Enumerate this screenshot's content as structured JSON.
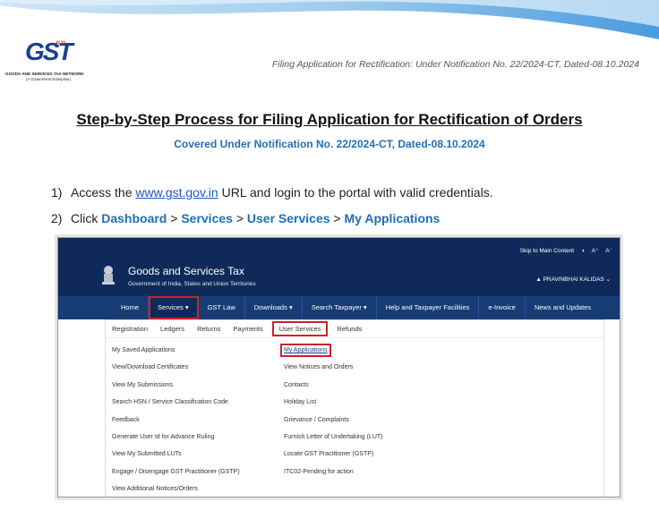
{
  "logo": {
    "text": "GST",
    "arrows": "«»",
    "line1": "GOODS AND SERVICES TAX NETWORK",
    "line2": "(A Government Enterprise)"
  },
  "header_note": "Filing Application for Rectification: Under Notification No. 22/2024-CT, Dated-08.10.2024",
  "title": "Step-by-Step Process for Filing Application for Rectification of Orders",
  "subtitle": "Covered Under Notification No. 22/2024-CT, Dated-08.10.2024",
  "steps": [
    {
      "num": "1)",
      "pre": "Access the ",
      "link": "www.gst.gov.in",
      "post": " URL and login to the portal with valid credentials."
    },
    {
      "num": "2)",
      "pre": "Click ",
      "path": [
        "Dashboard",
        "Services",
        "User Services",
        "My Applications"
      ],
      "sep": " > "
    }
  ],
  "portal": {
    "topbar": [
      "Skip to Main Content",
      "◑",
      "A⁺",
      "A⁻"
    ],
    "site_title": "Goods and Services Tax",
    "site_sub": "Government of India, States and Union Territories",
    "user": "▲ PRAVINBHAI KALIDAS ⌄",
    "nav": [
      "Home",
      "Services ▾",
      "GST Law",
      "Downloads ▾",
      "Search Taxpayer ▾",
      "Help and Taxpayer Facilities",
      "e-Invoice",
      "News and Updates"
    ],
    "sub_tabs": [
      "Registration",
      "Ledgers",
      "Returns",
      "Payments",
      "User Services",
      "Refunds"
    ],
    "left_links": [
      "My Saved Applications",
      "View/Download Certificates",
      "View My Submissions",
      "Search HSN / Service Classification Code",
      "Feedback",
      "Generate User Id for Advance Ruling",
      "View My Submitted LUTs",
      "Engage / Disengage GST Practitioner (GSTP)",
      "View Additional Notices/Orders"
    ],
    "right_links": [
      "My Applications",
      "View Notices and Orders",
      "Contacts",
      "Holiday List",
      "Grievance / Complaints",
      "Furnish Letter of Undertaking (LUT)",
      "Locate GST Practitioner (GSTP)",
      "ITC02-Pending for action"
    ]
  },
  "colors": {
    "accent": "#1f6fb5",
    "navy": "#0f2a5a",
    "highlight": "#d0202a"
  }
}
